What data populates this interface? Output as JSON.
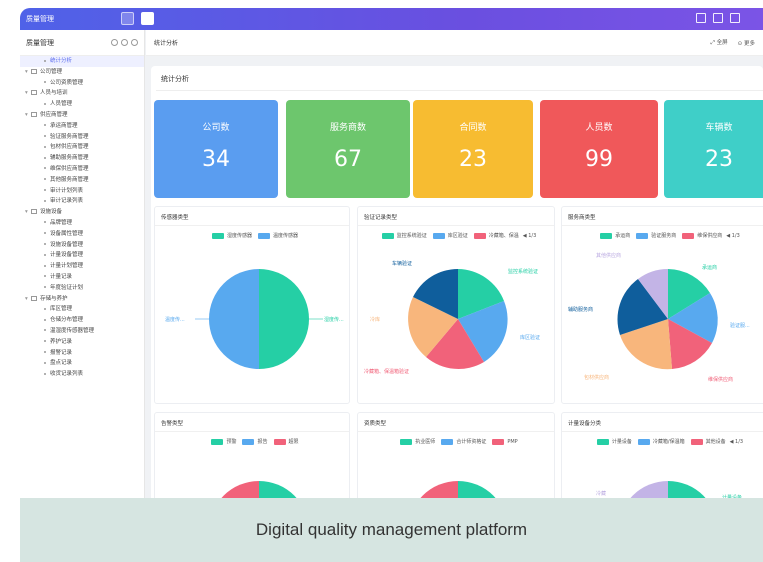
{
  "app": {
    "brand": "质量管理"
  },
  "sidebar": {
    "title": "质量管理",
    "items": [
      {
        "label": "统计分析",
        "level": 2,
        "active": true
      },
      {
        "label": "公司管理",
        "level": 1
      },
      {
        "label": "公司资质管理",
        "level": 2
      },
      {
        "label": "人员与培训",
        "level": 1
      },
      {
        "label": "人员管理",
        "level": 2
      },
      {
        "label": "供应商管理",
        "level": 1
      },
      {
        "label": "承运商管理",
        "level": 2
      },
      {
        "label": "验证服务商管理",
        "level": 2
      },
      {
        "label": "包材供应商管理",
        "level": 2
      },
      {
        "label": "辅助服务商管理",
        "level": 2
      },
      {
        "label": "维保供应商管理",
        "level": 2
      },
      {
        "label": "其他服务商管理",
        "level": 2
      },
      {
        "label": "审计计划列表",
        "level": 2
      },
      {
        "label": "审计记录列表",
        "level": 2
      },
      {
        "label": "设施设备",
        "level": 1
      },
      {
        "label": "品牌管理",
        "level": 2
      },
      {
        "label": "设备属性管理",
        "level": 2
      },
      {
        "label": "设施设备管理",
        "level": 2
      },
      {
        "label": "计量设备管理",
        "level": 2
      },
      {
        "label": "计量计划管理",
        "level": 2
      },
      {
        "label": "计量记录",
        "level": 2
      },
      {
        "label": "年度验证计划",
        "level": 2
      },
      {
        "label": "存储与养护",
        "level": 1
      },
      {
        "label": "库区管理",
        "level": 2
      },
      {
        "label": "仓储分布管理",
        "level": 2
      },
      {
        "label": "温湿度传感器管理",
        "level": 2
      },
      {
        "label": "养护记录",
        "level": 2
      },
      {
        "label": "报警记录",
        "level": 2
      },
      {
        "label": "盘点记录",
        "level": 2
      },
      {
        "label": "收货记录列表",
        "level": 2
      }
    ]
  },
  "breadcrumb": "统计分析",
  "header_actions": {
    "fullscreen": "全屏",
    "more": "更多"
  },
  "panel_title": "统计分析",
  "stats": [
    {
      "label": "公司数",
      "value": "34",
      "color": "#5a9df0"
    },
    {
      "label": "服务商数",
      "value": "67",
      "color": "#6dc66d"
    },
    {
      "label": "合同数",
      "value": "23",
      "color": "#f7bc31"
    },
    {
      "label": "人员数",
      "value": "99",
      "color": "#f0585a"
    },
    {
      "label": "车辆数",
      "value": "23",
      "color": "#3fcfc8"
    }
  ],
  "cards": [
    {
      "title": "传感器类型",
      "legend": [
        {
          "name": "湿度传感器",
          "color": "#25cfa5"
        },
        {
          "name": "温度传感器",
          "color": "#58a9ef"
        }
      ],
      "labels": [
        "温度传...",
        "湿度传..."
      ]
    },
    {
      "title": "验证记录类型",
      "legend": [
        {
          "name": "监控系统验证",
          "color": "#25cfa5"
        },
        {
          "name": "库区验证",
          "color": "#58a9ef"
        },
        {
          "name": "冷藏箱、保温",
          "color": "#f1627a"
        }
      ],
      "pager": "1/3",
      "labels": [
        "车辆验证",
        "监控系统验证",
        "库区验证",
        "冷藏箱、保温箱验证",
        "冷库"
      ]
    },
    {
      "title": "服务商类型",
      "legend": [
        {
          "name": "承运商",
          "color": "#25cfa5"
        },
        {
          "name": "验证服务商",
          "color": "#58a9ef"
        },
        {
          "name": "维保供应商",
          "color": "#f1627a"
        }
      ],
      "pager": "1/3",
      "labels": [
        "承运商",
        "验证服...",
        "维保供应商",
        "包材供应商",
        "辅助服务商",
        "其他供应商"
      ]
    },
    {
      "title": "告警类型",
      "legend": [
        {
          "name": "预警",
          "color": "#25cfa5"
        },
        {
          "name": "报告",
          "color": "#58a9ef"
        },
        {
          "name": "超限",
          "color": "#f1627a"
        }
      ]
    },
    {
      "title": "资质类型",
      "legend": [
        {
          "name": "执业医师",
          "color": "#25cfa5"
        },
        {
          "name": "合计师资格证",
          "color": "#58a9ef"
        },
        {
          "name": "PMP",
          "color": "#f1627a"
        }
      ]
    },
    {
      "title": "计量设备分类",
      "legend": [
        {
          "name": "计量设备",
          "color": "#25cfa5"
        },
        {
          "name": "冷藏箱/保温箱",
          "color": "#58a9ef"
        },
        {
          "name": "其他设备",
          "color": "#f1627a"
        }
      ],
      "pager": "1/3",
      "labels": [
        "计量设备",
        "冷藏"
      ]
    }
  ],
  "caption": "Digital quality management platform"
}
